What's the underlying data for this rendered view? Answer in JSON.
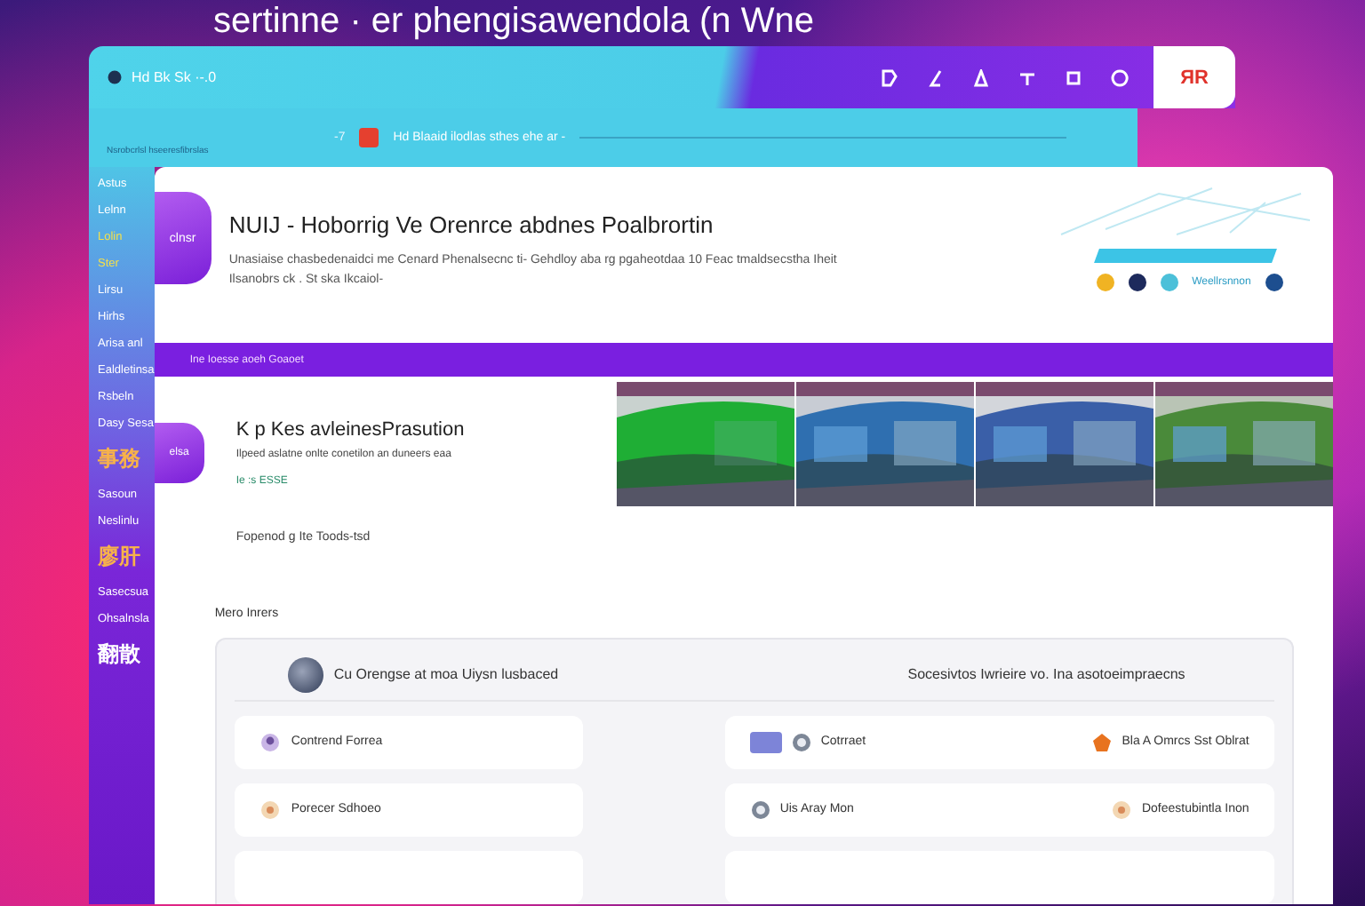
{
  "headline": "sertinne · er phengisawendola (n Wne",
  "topbar": {
    "title": "Hd Bk Sk ·-.0",
    "action": "ЯR"
  },
  "subbar": {
    "hint": "Nsrobcrlsl hseeresfibrslas",
    "count": "-7",
    "text": "Hd Blaaid ilodlas sthes ehe ar -"
  },
  "sidebar": {
    "items": [
      {
        "label": "Astus",
        "color": "#ffffff"
      },
      {
        "label": "Lelnn",
        "color": "#ffffff"
      },
      {
        "label": "Lolin",
        "color": "#f5e04a"
      },
      {
        "label": "Ster",
        "color": "#f5e04a"
      },
      {
        "label": "Lirsu",
        "color": "#ffffff"
      },
      {
        "label": "Hirhs",
        "color": "#ffffff"
      },
      {
        "label": "Arisa anl",
        "color": "#ffffff"
      },
      {
        "label": "Ealdletinsa",
        "color": "#ffffff"
      },
      {
        "label": "Rsbeln",
        "color": "#ffffff"
      },
      {
        "label": "Dasy Sesa",
        "color": "#ffffff"
      },
      {
        "label": "事務",
        "color": "#f7b24a"
      },
      {
        "label": "Sasoun",
        "color": "#ffffff"
      },
      {
        "label": "Neslinlu",
        "color": "#ffffff"
      },
      {
        "label": "廖肝",
        "color": "#f7b24a"
      },
      {
        "label": "Sasecsua",
        "color": "#ffffff"
      },
      {
        "label": "Ohsalnsla",
        "color": "#ffffff"
      },
      {
        "label": "翻散",
        "color": "#ffffff"
      }
    ]
  },
  "hero": {
    "logo": "clnsr",
    "title": "NUIJ -  Hoborrig  Ve Orenrce  abdnes Poalbrortin",
    "description": "Unasiaise chasbedenaidci me Cenard Phenalsecnc ti-  Gehdloy aba rg pgaheotdaa 10 Feac tmaldsecstha  Iheit Ilsanobrs ck .  St ska Ikcaiol-",
    "chip": "Weellrsnnon",
    "dots": [
      {
        "color": "#f0b323"
      },
      {
        "color": "#1d2a5c"
      },
      {
        "color": "#4cc0d9"
      },
      {
        "color": "#1d4e8f"
      }
    ]
  },
  "band": "Ine Ioesse aoeh Goaoet",
  "feature": {
    "logo": "elsa",
    "title": "K p Kes avleinesPrasution",
    "description": "Ilpeed  aslatne onlte conetilon an duneers eaa",
    "tag": "Ie :s ESSE",
    "footer": "Fopenod g Ite Toods-tsd"
  },
  "more": {
    "label": "Mero Inrers",
    "header_left": "Cu Orengse at moa Uiysn lusbaced",
    "header_right": "Socesivtos Iwrieire vo. Ina asotoeimpraecns",
    "rows": [
      {
        "left": "Contrend Forrea",
        "right": [
          "Cotrraet",
          "Bla A Omrcs Sst Oblrat"
        ]
      },
      {
        "left": "Porecer Sdhoeo",
        "right": [
          "Uis Aray Mon",
          "Dofeestubintla Inon"
        ]
      }
    ]
  }
}
